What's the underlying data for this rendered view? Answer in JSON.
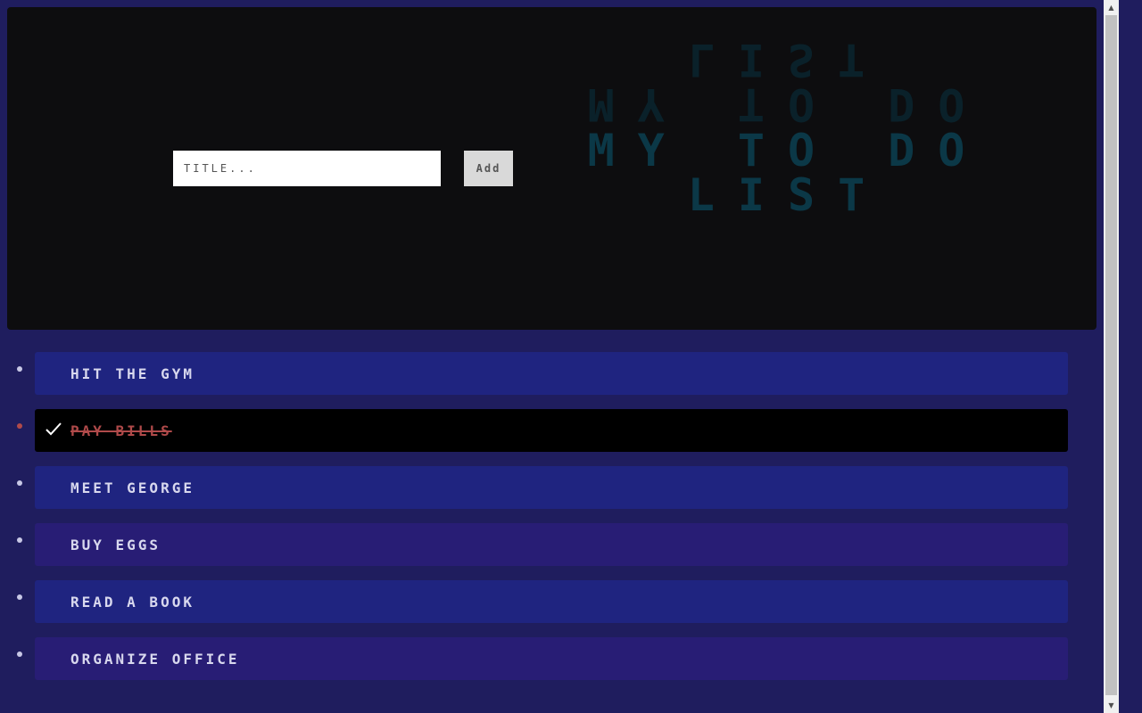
{
  "header": {
    "input": {
      "placeholder": "Title...",
      "value": ""
    },
    "add_label": "Add",
    "heading": "My To Do List"
  },
  "colors": {
    "page_bg": "#1f1d5e",
    "header_bg": "#0d0d0f",
    "heading": "#0b3847",
    "item_blue": "#1f2480",
    "item_purple": "#281d75",
    "done_bg": "#000000",
    "done_text": "#b04a4a"
  },
  "todos": [
    {
      "label": "Hit the gym",
      "done": false,
      "color": "#1f2480"
    },
    {
      "label": "Pay bills",
      "done": true,
      "color": "#000000"
    },
    {
      "label": "Meet George",
      "done": false,
      "color": "#1f2480"
    },
    {
      "label": "Buy eggs",
      "done": false,
      "color": "#281d75"
    },
    {
      "label": "Read a book",
      "done": false,
      "color": "#1f2480"
    },
    {
      "label": "Organize office",
      "done": false,
      "color": "#281d75"
    }
  ],
  "icons": {
    "check": "checkmark-icon",
    "scroll_up": "scroll-up-arrow-icon",
    "scroll_down": "scroll-down-arrow-icon"
  }
}
